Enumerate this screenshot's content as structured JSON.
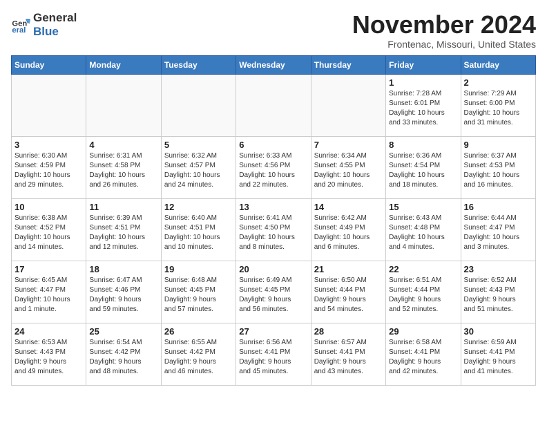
{
  "header": {
    "logo_general": "General",
    "logo_blue": "Blue",
    "month_title": "November 2024",
    "location": "Frontenac, Missouri, United States"
  },
  "days_of_week": [
    "Sunday",
    "Monday",
    "Tuesday",
    "Wednesday",
    "Thursday",
    "Friday",
    "Saturday"
  ],
  "weeks": [
    [
      {
        "day": "",
        "info": ""
      },
      {
        "day": "",
        "info": ""
      },
      {
        "day": "",
        "info": ""
      },
      {
        "day": "",
        "info": ""
      },
      {
        "day": "",
        "info": ""
      },
      {
        "day": "1",
        "info": "Sunrise: 7:28 AM\nSunset: 6:01 PM\nDaylight: 10 hours\nand 33 minutes."
      },
      {
        "day": "2",
        "info": "Sunrise: 7:29 AM\nSunset: 6:00 PM\nDaylight: 10 hours\nand 31 minutes."
      }
    ],
    [
      {
        "day": "3",
        "info": "Sunrise: 6:30 AM\nSunset: 4:59 PM\nDaylight: 10 hours\nand 29 minutes."
      },
      {
        "day": "4",
        "info": "Sunrise: 6:31 AM\nSunset: 4:58 PM\nDaylight: 10 hours\nand 26 minutes."
      },
      {
        "day": "5",
        "info": "Sunrise: 6:32 AM\nSunset: 4:57 PM\nDaylight: 10 hours\nand 24 minutes."
      },
      {
        "day": "6",
        "info": "Sunrise: 6:33 AM\nSunset: 4:56 PM\nDaylight: 10 hours\nand 22 minutes."
      },
      {
        "day": "7",
        "info": "Sunrise: 6:34 AM\nSunset: 4:55 PM\nDaylight: 10 hours\nand 20 minutes."
      },
      {
        "day": "8",
        "info": "Sunrise: 6:36 AM\nSunset: 4:54 PM\nDaylight: 10 hours\nand 18 minutes."
      },
      {
        "day": "9",
        "info": "Sunrise: 6:37 AM\nSunset: 4:53 PM\nDaylight: 10 hours\nand 16 minutes."
      }
    ],
    [
      {
        "day": "10",
        "info": "Sunrise: 6:38 AM\nSunset: 4:52 PM\nDaylight: 10 hours\nand 14 minutes."
      },
      {
        "day": "11",
        "info": "Sunrise: 6:39 AM\nSunset: 4:51 PM\nDaylight: 10 hours\nand 12 minutes."
      },
      {
        "day": "12",
        "info": "Sunrise: 6:40 AM\nSunset: 4:51 PM\nDaylight: 10 hours\nand 10 minutes."
      },
      {
        "day": "13",
        "info": "Sunrise: 6:41 AM\nSunset: 4:50 PM\nDaylight: 10 hours\nand 8 minutes."
      },
      {
        "day": "14",
        "info": "Sunrise: 6:42 AM\nSunset: 4:49 PM\nDaylight: 10 hours\nand 6 minutes."
      },
      {
        "day": "15",
        "info": "Sunrise: 6:43 AM\nSunset: 4:48 PM\nDaylight: 10 hours\nand 4 minutes."
      },
      {
        "day": "16",
        "info": "Sunrise: 6:44 AM\nSunset: 4:47 PM\nDaylight: 10 hours\nand 3 minutes."
      }
    ],
    [
      {
        "day": "17",
        "info": "Sunrise: 6:45 AM\nSunset: 4:47 PM\nDaylight: 10 hours\nand 1 minute."
      },
      {
        "day": "18",
        "info": "Sunrise: 6:47 AM\nSunset: 4:46 PM\nDaylight: 9 hours\nand 59 minutes."
      },
      {
        "day": "19",
        "info": "Sunrise: 6:48 AM\nSunset: 4:45 PM\nDaylight: 9 hours\nand 57 minutes."
      },
      {
        "day": "20",
        "info": "Sunrise: 6:49 AM\nSunset: 4:45 PM\nDaylight: 9 hours\nand 56 minutes."
      },
      {
        "day": "21",
        "info": "Sunrise: 6:50 AM\nSunset: 4:44 PM\nDaylight: 9 hours\nand 54 minutes."
      },
      {
        "day": "22",
        "info": "Sunrise: 6:51 AM\nSunset: 4:44 PM\nDaylight: 9 hours\nand 52 minutes."
      },
      {
        "day": "23",
        "info": "Sunrise: 6:52 AM\nSunset: 4:43 PM\nDaylight: 9 hours\nand 51 minutes."
      }
    ],
    [
      {
        "day": "24",
        "info": "Sunrise: 6:53 AM\nSunset: 4:43 PM\nDaylight: 9 hours\nand 49 minutes."
      },
      {
        "day": "25",
        "info": "Sunrise: 6:54 AM\nSunset: 4:42 PM\nDaylight: 9 hours\nand 48 minutes."
      },
      {
        "day": "26",
        "info": "Sunrise: 6:55 AM\nSunset: 4:42 PM\nDaylight: 9 hours\nand 46 minutes."
      },
      {
        "day": "27",
        "info": "Sunrise: 6:56 AM\nSunset: 4:41 PM\nDaylight: 9 hours\nand 45 minutes."
      },
      {
        "day": "28",
        "info": "Sunrise: 6:57 AM\nSunset: 4:41 PM\nDaylight: 9 hours\nand 43 minutes."
      },
      {
        "day": "29",
        "info": "Sunrise: 6:58 AM\nSunset: 4:41 PM\nDaylight: 9 hours\nand 42 minutes."
      },
      {
        "day": "30",
        "info": "Sunrise: 6:59 AM\nSunset: 4:41 PM\nDaylight: 9 hours\nand 41 minutes."
      }
    ]
  ]
}
